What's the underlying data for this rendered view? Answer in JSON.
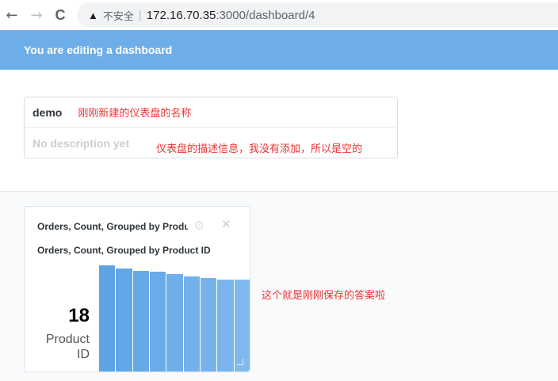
{
  "browser": {
    "back": "←",
    "forward": "→",
    "reload": "C",
    "warning_symbol": "▲",
    "insecure_label": "不安全",
    "separator": "|",
    "url_host": "172.16.70.35",
    "url_path": ":3000/dashboard/4"
  },
  "edit_bar": {
    "text": "You are editing a dashboard"
  },
  "dashboard": {
    "name": "demo",
    "description_placeholder": "No description yet"
  },
  "annotations": {
    "name_note": "刚刚新建的仪表盘的名称",
    "description_note": "仪表盘的描述信息，我没有添加，所以是空的",
    "card_note": "这个就是刚刚保存的答案啦"
  },
  "card": {
    "title": "Orders, Count, Grouped by Product ID",
    "subtitle": "Orders, Count, Grouped by Product ID",
    "gear_icon": "⚙",
    "close_icon": "✕",
    "value": "18",
    "value_label_line1": "Product",
    "value_label_line2": "ID"
  },
  "chart_data": {
    "type": "bar",
    "bar_levels": [
      1.0,
      0.97,
      0.95,
      0.94,
      0.92,
      0.9,
      0.88,
      0.87,
      0.87
    ],
    "colors": [
      "#5ea3e6",
      "#62a6e7",
      "#66a9e8",
      "#6aabe9",
      "#6eaeea",
      "#72b1eb",
      "#76b3ec",
      "#7ab6ed",
      "#7fb9ee"
    ]
  }
}
